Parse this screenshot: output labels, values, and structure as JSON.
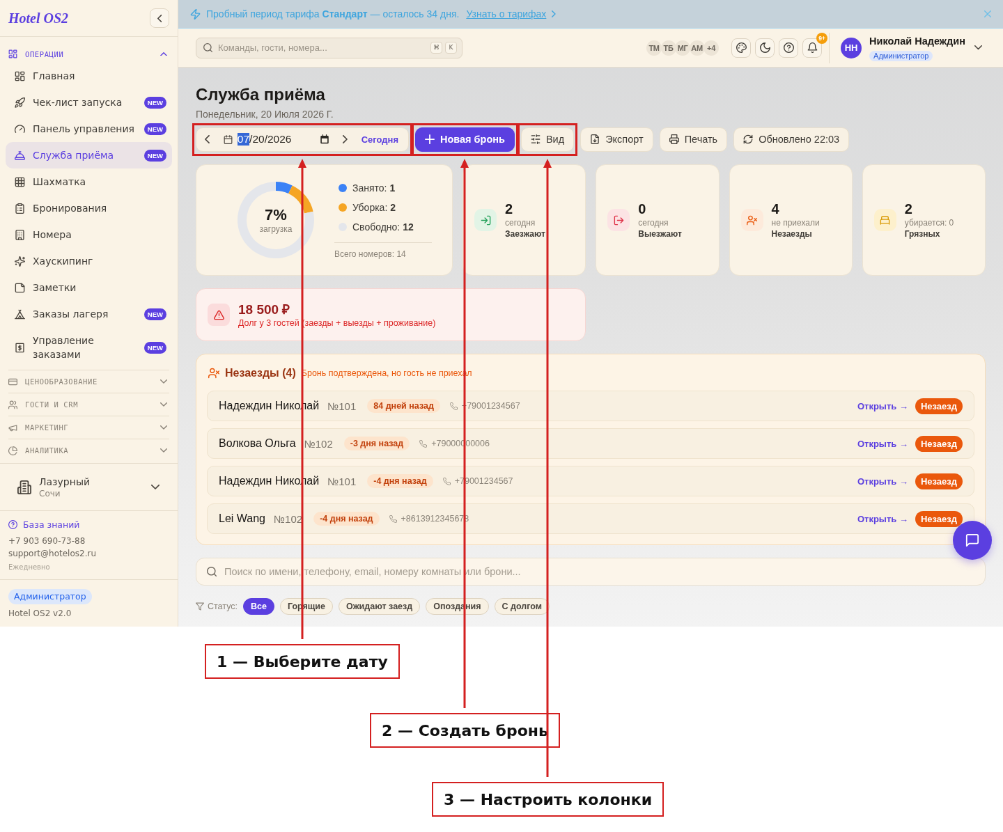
{
  "sidebar": {
    "logo": "Hotel OS2",
    "groups": [
      {
        "label": "ОПЕРАЦИИ",
        "expanded": true,
        "items": [
          {
            "label": "Главная",
            "selected": false
          },
          {
            "label": "Чек-лист запуска",
            "badge": "NEW",
            "selected": false
          },
          {
            "label": "Панель управления",
            "badge": "NEW",
            "selected": false
          },
          {
            "label": "Служба приёма",
            "badge": "NEW",
            "selected": true
          },
          {
            "label": "Шахматка",
            "selected": false
          },
          {
            "label": "Бронирования",
            "selected": false
          },
          {
            "label": "Номера",
            "selected": false
          },
          {
            "label": "Хаускипинг",
            "selected": false
          },
          {
            "label": "Заметки",
            "selected": false
          },
          {
            "label": "Заказы лагеря",
            "badge": "NEW",
            "selected": false
          },
          {
            "label": "Управление заказами",
            "badge": "NEW",
            "selected": false
          }
        ]
      },
      {
        "label": "ЦЕНООБРАЗОВАНИЕ",
        "expanded": false
      },
      {
        "label": "ГОСТИ И CRM",
        "expanded": false
      },
      {
        "label": "МАРКЕТИНГ",
        "expanded": false
      },
      {
        "label": "АНАЛИТИКА",
        "expanded": false
      }
    ],
    "hotel": {
      "name": "Лазурный",
      "city": "Сочи"
    },
    "support": {
      "link": "База знаний",
      "phone": "+7 903 690-73-88",
      "email": "support@hotelos2.ru",
      "hours": "Ежедневно"
    },
    "role": "Администратор",
    "version": "Hotel OS2 v2.0"
  },
  "banner": {
    "text": "Пробный период тарифа **Стандарт** — осталось 34 дня.",
    "link": "Узнать о тарифах"
  },
  "topbar": {
    "search": {
      "placeholder": "Команды, гости, номера...",
      "keys": [
        "⌘",
        "K"
      ]
    },
    "team": [
      "ТМ",
      "ТБ",
      "МГ",
      "АМ"
    ],
    "team_more": "+4",
    "notifications": "9+",
    "user": {
      "initials": "НН",
      "name": "Николай Надеждин",
      "role": "Администратор"
    }
  },
  "page": {
    "title": "Служба приёма",
    "date": "Понедельник, 20 Июля 2026 Г."
  },
  "toolbar": {
    "date": {
      "highlighted": true,
      "segments": [
        {
          "text": "07",
          "selected": true
        },
        {
          "text": "20",
          "selected": false
        },
        {
          "text": "2026",
          "selected": false
        }
      ],
      "separators": [
        "/",
        "/"
      ]
    },
    "today": "Сегодня",
    "buttons": [
      {
        "kind": "create",
        "label": "Новая бронь",
        "highlighted": true
      },
      {
        "kind": "view",
        "label": "Вид",
        "highlighted": true
      },
      {
        "kind": "export",
        "label": "Экспорт",
        "highlighted": false
      },
      {
        "kind": "print",
        "label": "Печать",
        "highlighted": false
      },
      {
        "kind": "refresh",
        "label": "Обновлено 22:03",
        "highlighted": false
      }
    ]
  },
  "occupancy": {
    "percent": "7%",
    "caption": "загрузка",
    "chart_data": {
      "type": "donut",
      "values": [
        7.1,
        14.3,
        78.6
      ]
    },
    "legend": [
      {
        "text": "Занято: **1**",
        "color": "#3b82f6"
      },
      {
        "text": "Уборка: **2**",
        "color": "#f5a524"
      },
      {
        "text": "Свободно: **12**",
        "color": "#e4e6eb"
      }
    ],
    "total": "Всего номеров: 14"
  },
  "stats": [
    {
      "kind": "arrivals",
      "value": "2",
      "sublabel": "сегодня",
      "label": "Заезжают"
    },
    {
      "kind": "departures",
      "value": "0",
      "sublabel": "сегодня",
      "label": "Выезжают"
    },
    {
      "kind": "no_shows",
      "value": "4",
      "sublabel": "не приехали",
      "label": "Незаезды"
    },
    {
      "kind": "dirty",
      "value": "2",
      "sublabel": "убирается: 0",
      "label": "Грязных"
    }
  ],
  "debt": {
    "amount": "18 500 ₽",
    "description": "Долг у 3 гостей (заезды + выезды + проживание)"
  },
  "no_shows": {
    "title": "Незаезды (4)",
    "subtitle": "Бронь подтверждена, но гость не приехал",
    "rows": [
      {
        "name": "Надеждин Николай",
        "room": "№101",
        "ago": "84 дней назад",
        "phone": "+79001234567",
        "action": "Открыть →",
        "status": "Незаезд"
      },
      {
        "name": "Волкова Ольга",
        "room": "№102",
        "ago": "-3 дня назад",
        "phone": "+79000000006",
        "action": "Открыть →",
        "status": "Незаезд"
      },
      {
        "name": "Надеждин Николай",
        "room": "№101",
        "ago": "-4 дня назад",
        "phone": "+79001234567",
        "action": "Открыть →",
        "status": "Незаезд"
      },
      {
        "name": "Lei Wang",
        "room": "№102",
        "ago": "-4 дня назад",
        "phone": "+8613912345678",
        "action": "Открыть →",
        "status": "Незаезд"
      }
    ]
  },
  "search": {
    "placeholder": "Поиск по имени, телефону, email, номеру комнаты или брони..."
  },
  "filters": {
    "label": "Статус:",
    "chips": [
      {
        "label": "Все",
        "selected": true
      },
      {
        "label": "Горящие",
        "selected": false
      },
      {
        "label": "Ожидают заезд",
        "selected": false
      },
      {
        "label": "Опоздания",
        "selected": false
      },
      {
        "label": "С долгом",
        "selected": false
      }
    ]
  },
  "annotations": [
    {
      "text": "1 — Выберите дату"
    },
    {
      "text": "2 — Создать бронь"
    },
    {
      "text": "3 — Настроить колонки"
    }
  ]
}
